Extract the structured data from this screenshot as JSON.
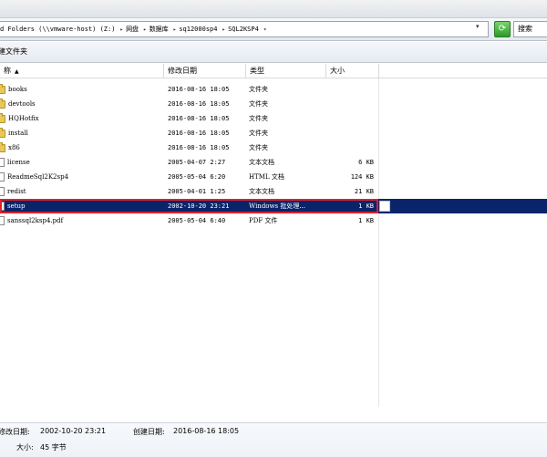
{
  "address": {
    "crumbs": [
      "d Folders (\\\\vmware-host) (Z:)",
      "网盘",
      "数据库",
      "sq12000sp4",
      "SQL2KSP4"
    ],
    "search_placeholder": "搜索"
  },
  "toolbar": {
    "new_folder_label": "建文件夹"
  },
  "columns": {
    "name": "称",
    "date": "修改日期",
    "type": "类型",
    "size": "大小"
  },
  "files": [
    {
      "name": "books",
      "date": "2016-08-16 18:05",
      "type": "文件夹",
      "size": "",
      "icon": "folder-icon"
    },
    {
      "name": "devtools",
      "date": "2016-08-16 18:05",
      "type": "文件夹",
      "size": "",
      "icon": "folder-icon"
    },
    {
      "name": "HQHotfix",
      "date": "2016-08-16 18:05",
      "type": "文件夹",
      "size": "",
      "icon": "folder-icon"
    },
    {
      "name": "install",
      "date": "2016-08-16 18:05",
      "type": "文件夹",
      "size": "",
      "icon": "folder-icon"
    },
    {
      "name": "x86",
      "date": "2016-08-16 18:05",
      "type": "文件夹",
      "size": "",
      "icon": "folder-icon"
    },
    {
      "name": "license",
      "date": "2005-04-07 2:27",
      "type": "文本文档",
      "size": "6 KB",
      "icon": "file-icon"
    },
    {
      "name": "ReadmeSql2K2sp4",
      "date": "2005-05-04 6:20",
      "type": "HTML 文档",
      "size": "124 KB",
      "icon": "file-icon"
    },
    {
      "name": "redist",
      "date": "2005-04-01 1:25",
      "type": "文本文档",
      "size": "21 KB",
      "icon": "file-icon"
    },
    {
      "name": "setup",
      "date": "2002-10-20 23:21",
      "type": "Windows 批处理...",
      "size": "1 KB",
      "icon": "file-icon",
      "selected": true
    },
    {
      "name": "sanssql2ksp4.pdf",
      "date": "2005-05-04 6:40",
      "type": "PDF 文件",
      "size": "1 KB",
      "icon": "file-icon"
    }
  ],
  "details": {
    "modified_label": "修改日期:",
    "modified_value": "2002-10-20 23:21",
    "created_label": "创建日期:",
    "created_value": "2016-08-16 18:05",
    "size_label": "大小:",
    "size_value": "45 字节"
  }
}
